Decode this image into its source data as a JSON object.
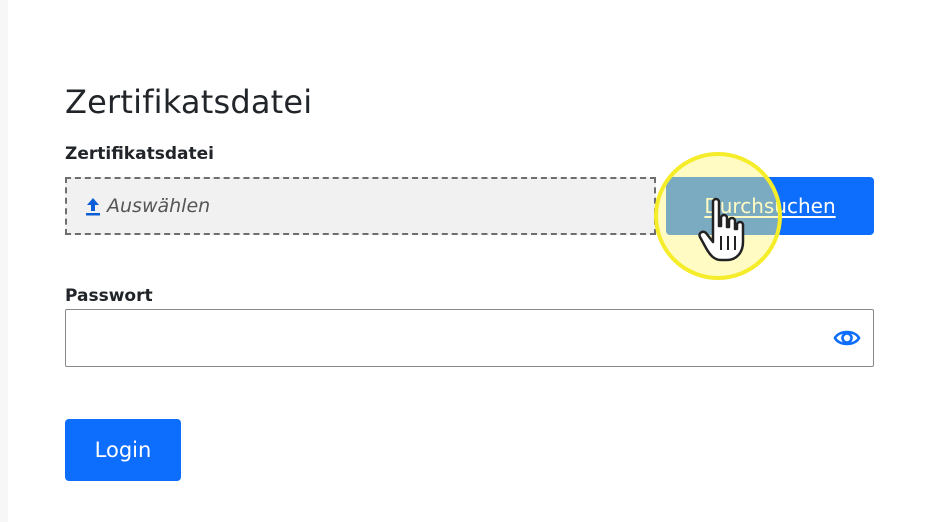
{
  "form": {
    "title": "Zertifikatsdatei",
    "certificate": {
      "label": "Zertifikatsdatei",
      "choose_text": "Auswählen",
      "upload_icon": "upload-arrow-icon",
      "browse_label": "Durchsuchen"
    },
    "password": {
      "label": "Passwort",
      "value": "",
      "toggle_icon": "eye-icon"
    },
    "login_label": "Login"
  },
  "colors": {
    "primary": "#0d6efd",
    "highlight": "#f5ec2a",
    "drop_zone_bg": "#f1f1f1"
  }
}
